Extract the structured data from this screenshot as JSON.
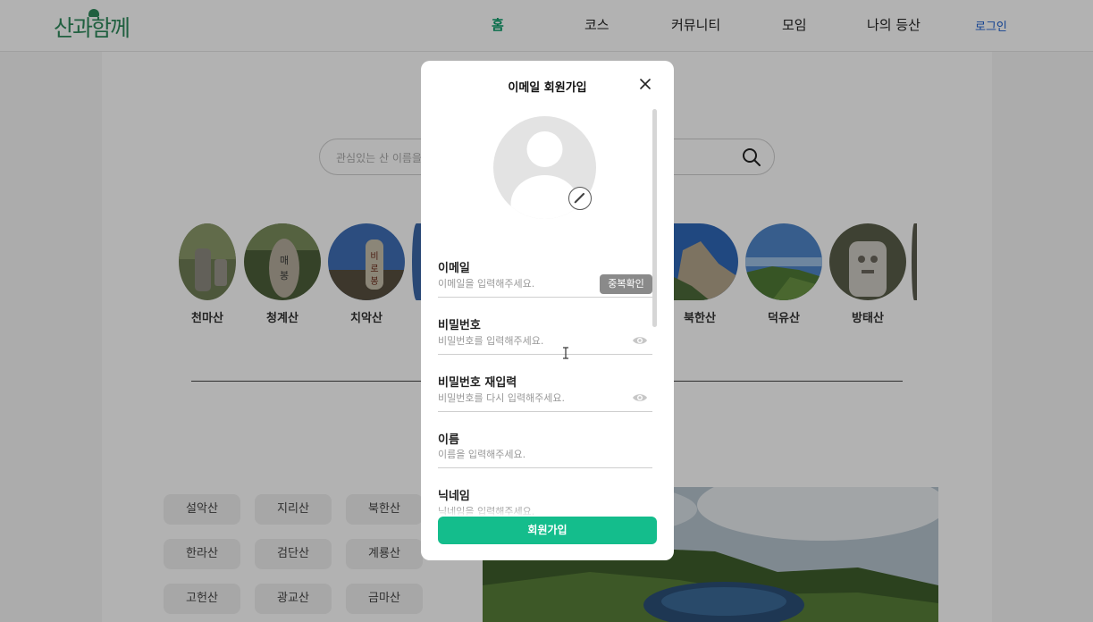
{
  "header": {
    "logo": "산과함께",
    "nav": [
      {
        "label": "홈",
        "active": true
      },
      {
        "label": "코스",
        "active": false
      },
      {
        "label": "커뮤니티",
        "active": false
      },
      {
        "label": "모임",
        "active": false
      },
      {
        "label": "나의 등산",
        "active": false
      }
    ],
    "login_label": "로그인"
  },
  "search": {
    "placeholder": "관심있는 산 이름을"
  },
  "mountains": [
    {
      "name": "천마산"
    },
    {
      "name": "청계산"
    },
    {
      "name": "치악산"
    },
    {
      "name": ""
    },
    {
      "name": "북한산"
    },
    {
      "name": "덕유산"
    },
    {
      "name": "방태산"
    }
  ],
  "chips": [
    "설악산",
    "지리산",
    "북한산",
    "한라산",
    "검단산",
    "계룡산",
    "고헌산",
    "광교산",
    "금마산"
  ],
  "modal": {
    "title": "이메일 회원가입",
    "fields": [
      {
        "label": "이메일",
        "placeholder": "이메일을 입력해주세요."
      },
      {
        "label": "비밀번호",
        "placeholder": "비밀번호를 입력해주세요."
      },
      {
        "label": "비밀번호 재입력",
        "placeholder": "비밀번호를 다시 입력해주세요."
      },
      {
        "label": "이름",
        "placeholder": "이름을 입력해주세요."
      },
      {
        "label": "닉네임",
        "placeholder": "닉네임을 입력해주세요."
      }
    ],
    "dup_check_label": "중복확인",
    "submit_label": "회원가입"
  },
  "colors": {
    "brand": "#2f8a5c",
    "nav_active": "#0c9c6a",
    "submit": "#14bd8c",
    "login": "#1c5fd0"
  }
}
